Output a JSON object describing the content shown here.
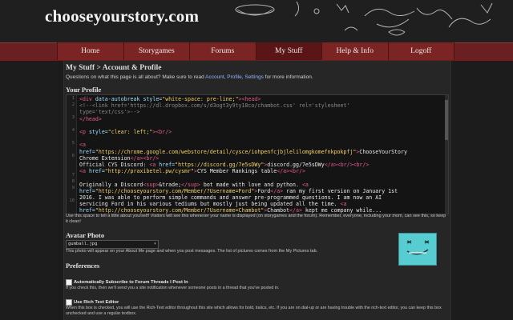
{
  "site": {
    "logo": "chooseyourstory.com"
  },
  "nav": {
    "items": [
      {
        "label": "Home",
        "active": false
      },
      {
        "label": "Storygames",
        "active": false
      },
      {
        "label": "Forums",
        "active": false
      },
      {
        "label": "My Stuff",
        "active": true
      },
      {
        "label": "Help & Info",
        "active": false
      },
      {
        "label": "Logoff",
        "active": false
      }
    ]
  },
  "page": {
    "breadcrumb": "My Stuff > Account & Profile",
    "intro": {
      "prefix": "Questions on what this page is all about? Make sure to read ",
      "links": [
        "Account",
        "Profile",
        "Settings"
      ],
      "sep1": ", ",
      "sep2": ", ",
      "suffix": " for more information."
    }
  },
  "profile": {
    "title": "Your Profile",
    "line_numbers": [
      "1",
      "2",
      "",
      "3",
      "",
      "4",
      "",
      "5",
      "",
      "6",
      "",
      "",
      "7",
      "8",
      "9",
      "",
      "10",
      "",
      "",
      "",
      ""
    ],
    "help": "Use this space to tell a little about yourself! Visitors will see this whenever your name is displayed (on storygames and the forum). Remember, everyone, including your mom, can see this, so keep it clean!"
  },
  "avatar": {
    "title": "Avatar Photo",
    "selected": "gumball.jpg",
    "help": "This photo will appear on your About Me page and when you post messages. The list of pictures comes from the My Pictures tab."
  },
  "preferences": {
    "title": "Preferences",
    "items": [
      {
        "label": "Automatically Subscribe to Forum Threads I Post In",
        "desc": "If you check this, then we'll send you a site notification whenever someone posts in a thread that you've posted in."
      },
      {
        "label": "Use Rich Text Editor",
        "desc": "When this box is checked, you will use the Rich-Text editor throughout this site which allows for bold, italics, etc. If you are on dial-up or are having trouble with the rich-text editor, you can keep this box unchecked and use a regular textbox."
      }
    ]
  },
  "colors": {
    "accent": "#7a2424",
    "link": "#8fb6ff",
    "avatar_bg": "#57cdd1"
  },
  "icons": {
    "select_arrow": "chevron-down-icon"
  }
}
